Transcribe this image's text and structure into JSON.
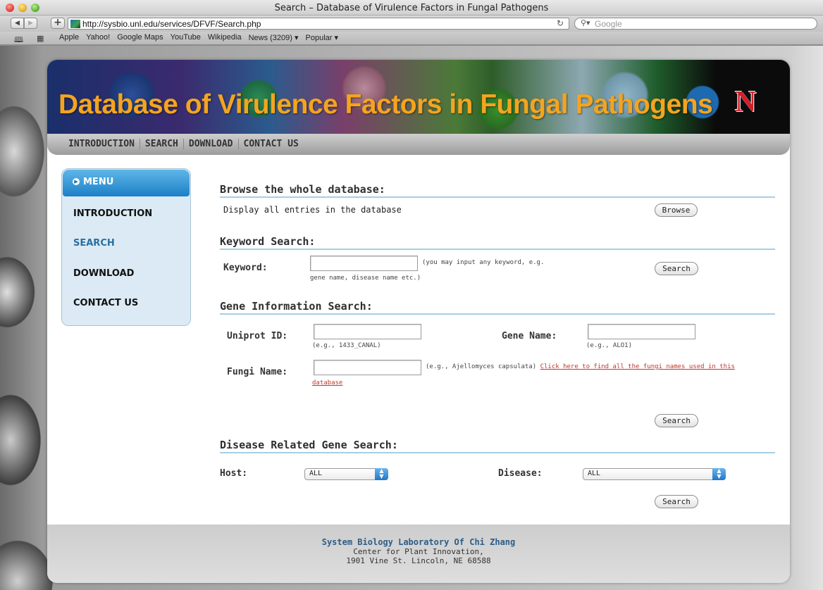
{
  "window": {
    "title": "Search – Database of Virulence Factors in Fungal Pathogens"
  },
  "toolbar": {
    "url": "http://sysbio.unl.edu/services/DFVF/Search.php",
    "search_placeholder": "Google"
  },
  "bookmarks": [
    "Apple",
    "Yahoo!",
    "Google Maps",
    "YouTube",
    "Wikipedia",
    "News (3209) ▾",
    "Popular ▾"
  ],
  "site": {
    "banner_title": "Database of Virulence Factors in Fungal Pathogens",
    "logo_letter": "N",
    "topnav": [
      "INTRODUCTION",
      "SEARCH",
      "DOWNLOAD",
      "CONTACT US"
    ]
  },
  "menu": {
    "header": "MENU",
    "items": [
      "INTRODUCTION",
      "SEARCH",
      "DOWNLOAD",
      "CONTACT US"
    ],
    "active": "SEARCH"
  },
  "browse": {
    "title": "Browse the whole database:",
    "description": "Display all entries in the database",
    "button": "Browse"
  },
  "keyword": {
    "title": "Keyword Search:",
    "label": "Keyword:",
    "value": "",
    "hint1": "(you may input any keyword, e.g.",
    "hint2": "gene name, disease name etc.)",
    "button": "Search"
  },
  "gene": {
    "title": "Gene Information Search:",
    "uniprot_label": "Uniprot ID:",
    "uniprot_value": "",
    "uniprot_hint": "(e.g., 1433_CANAL)",
    "genename_label": "Gene Name:",
    "genename_value": "",
    "genename_hint": "(e.g., ALO1)",
    "fungi_label": "Fungi Name:",
    "fungi_value": "",
    "fungi_hint": "(e.g., Ajellomyces capsulata)",
    "fungi_link1": "Click here to find all the fungi names used in this",
    "fungi_link2": "database",
    "button": "Search"
  },
  "disease": {
    "title": "Disease Related Gene Search:",
    "host_label": "Host:",
    "host_value": "ALL",
    "disease_label": "Disease:",
    "disease_value": "ALL",
    "button": "Search"
  },
  "footer": {
    "line1": "System Biology Laboratory Of Chi Zhang",
    "line2": "Center for Plant Innovation,",
    "line3": "1901 Vine St. Lincoln, NE 68588"
  },
  "colors": {
    "banner_title": "#f4a41f",
    "menu_header": "#1c80c6",
    "menu_bg": "#dbeaf4",
    "section_rule": "#a8cde6",
    "link": "#c0392b",
    "footer_accent": "#2d5c88"
  }
}
